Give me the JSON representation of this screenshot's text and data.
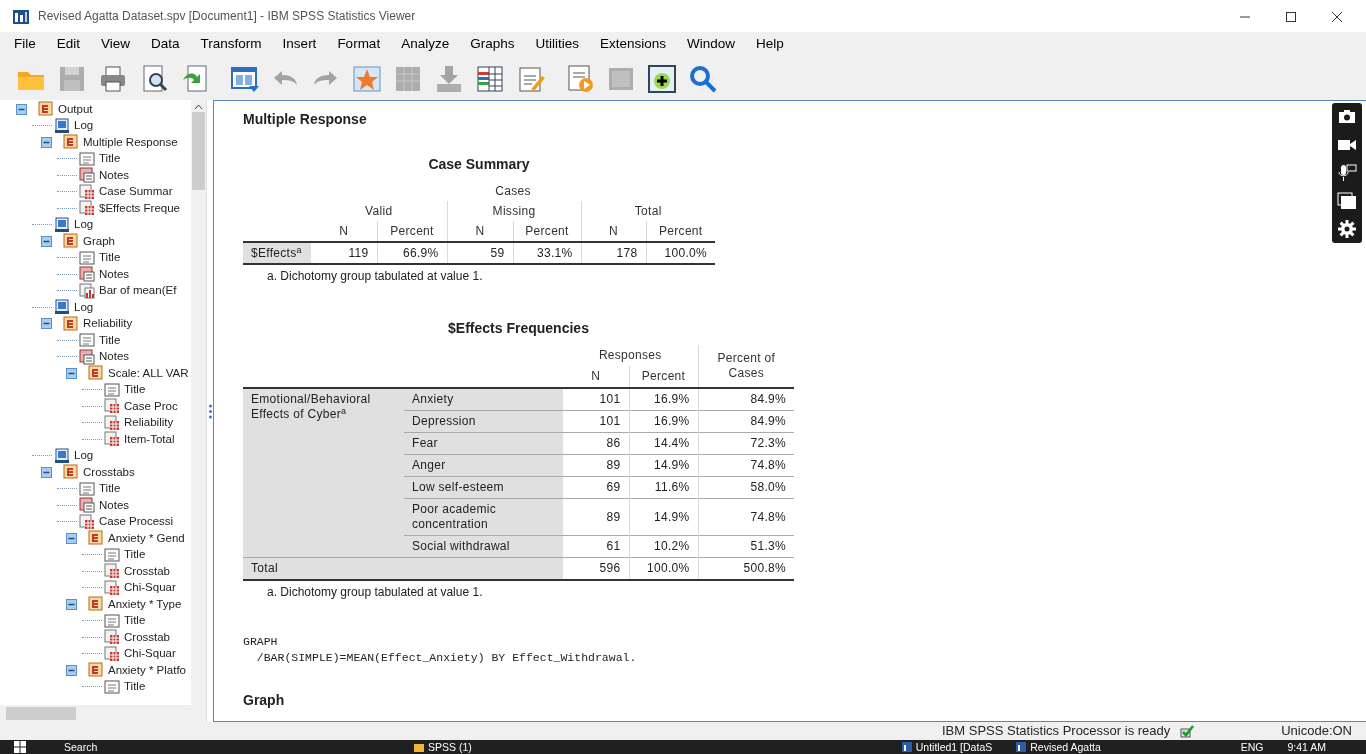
{
  "window": {
    "title": "Revised Agatta Dataset.spv [Document1] - IBM SPSS Statistics Viewer",
    "controls": [
      {
        "kind": "minimize"
      },
      {
        "kind": "maximize"
      },
      {
        "kind": "close"
      }
    ]
  },
  "menu": [
    {
      "label": "File"
    },
    {
      "label": "Edit"
    },
    {
      "label": "View"
    },
    {
      "label": "Data"
    },
    {
      "label": "Transform"
    },
    {
      "label": "Insert"
    },
    {
      "label": "Format"
    },
    {
      "label": "Analyze"
    },
    {
      "label": "Graphs"
    },
    {
      "label": "Utilities"
    },
    {
      "label": "Extensions"
    },
    {
      "label": "Window"
    },
    {
      "label": "Help"
    }
  ],
  "toolbar": [
    {
      "kind": "folder",
      "disabled": false
    },
    {
      "kind": "save",
      "disabled": true
    },
    {
      "kind": "print",
      "disabled": false
    },
    {
      "kind": "preview",
      "disabled": false
    },
    {
      "kind": "export",
      "disabled": false
    },
    {
      "kind": "window",
      "disabled": false
    },
    {
      "kind": "undo",
      "disabled": true
    },
    {
      "kind": "redo",
      "disabled": true
    },
    {
      "kind": "star",
      "disabled": false
    },
    {
      "kind": "grid",
      "disabled": true
    },
    {
      "kind": "download",
      "disabled": true
    },
    {
      "kind": "table",
      "disabled": false
    },
    {
      "kind": "edit",
      "disabled": false
    },
    {
      "kind": "play",
      "disabled": false
    },
    {
      "kind": "panel",
      "disabled": true
    },
    {
      "kind": "add",
      "disabled": false
    },
    {
      "kind": "search",
      "disabled": false
    }
  ],
  "tree": [
    {
      "label": "Output",
      "kind": "group",
      "expanded": true,
      "children": [
        {
          "label": "Log",
          "kind": "log"
        },
        {
          "label": "Multiple Response",
          "kind": "group",
          "expanded": true,
          "children": [
            {
              "label": "Title",
              "kind": "title"
            },
            {
              "label": "Notes",
              "kind": "notes"
            },
            {
              "label": "Case Summar",
              "kind": "table"
            },
            {
              "label": "$Effects Freque",
              "kind": "table"
            }
          ]
        },
        {
          "label": "Log",
          "kind": "log"
        },
        {
          "label": "Graph",
          "kind": "group",
          "expanded": true,
          "children": [
            {
              "label": "Title",
              "kind": "title"
            },
            {
              "label": "Notes",
              "kind": "notes"
            },
            {
              "label": "Bar of mean(Ef",
              "kind": "chart"
            }
          ]
        },
        {
          "label": "Log",
          "kind": "log"
        },
        {
          "label": "Reliability",
          "kind": "group",
          "expanded": true,
          "children": [
            {
              "label": "Title",
              "kind": "title"
            },
            {
              "label": "Notes",
              "kind": "notes"
            },
            {
              "label": "Scale: ALL VAR",
              "kind": "group",
              "expanded": true,
              "children": [
                {
                  "label": "Title",
                  "kind": "title"
                },
                {
                  "label": "Case Proc",
                  "kind": "table"
                },
                {
                  "label": "Reliability",
                  "kind": "table"
                },
                {
                  "label": "Item-Total",
                  "kind": "table"
                }
              ]
            }
          ]
        },
        {
          "label": "Log",
          "kind": "log"
        },
        {
          "label": "Crosstabs",
          "kind": "group",
          "expanded": true,
          "children": [
            {
              "label": "Title",
              "kind": "title"
            },
            {
              "label": "Notes",
              "kind": "notes"
            },
            {
              "label": "Case Processi",
              "kind": "table"
            },
            {
              "label": "Anxiety  * Gend",
              "kind": "group",
              "expanded": true,
              "children": [
                {
                  "label": "Title",
                  "kind": "title"
                },
                {
                  "label": "Crosstab",
                  "kind": "table"
                },
                {
                  "label": "Chi-Squar",
                  "kind": "table"
                }
              ]
            },
            {
              "label": "Anxiety  * Type",
              "kind": "group",
              "expanded": true,
              "children": [
                {
                  "label": "Title",
                  "kind": "title"
                },
                {
                  "label": "Crosstab",
                  "kind": "table"
                },
                {
                  "label": "Chi-Squar",
                  "kind": "table"
                }
              ]
            },
            {
              "label": "Anxiety  * Platfo",
              "kind": "group",
              "expanded": true,
              "children": [
                {
                  "label": "Title",
                  "kind": "title"
                }
              ]
            }
          ]
        }
      ]
    }
  ],
  "output": {
    "heading": "Multiple Response",
    "case_summary": {
      "title": "Case Summary",
      "group_header": "Cases",
      "groups": [
        "Valid",
        "Missing",
        "Total"
      ],
      "subheaders": [
        "N",
        "Percent",
        "N",
        "Percent",
        "N",
        "Percent"
      ],
      "rows": [
        {
          "label": "$Effects",
          "note": "a",
          "cells": [
            "119",
            "66.9%",
            "59",
            "33.1%",
            "178",
            "100.0%"
          ]
        }
      ],
      "footnote": "a. Dichotomy group tabulated at value 1."
    },
    "frequencies": {
      "title": "$Effects Frequencies",
      "group_header": "Responses",
      "subheaders": [
        "N",
        "Percent"
      ],
      "extra_header": "Percent of Cases",
      "group_label": "Emotional/Behavioral Effects of Cyber",
      "group_note": "a",
      "rows": [
        {
          "label": "Anxiety",
          "cells": [
            "101",
            "16.9%",
            "84.9%"
          ]
        },
        {
          "label": "Depression",
          "cells": [
            "101",
            "16.9%",
            "84.9%"
          ]
        },
        {
          "label": "Fear",
          "cells": [
            "86",
            "14.4%",
            "72.3%"
          ]
        },
        {
          "label": "Anger",
          "cells": [
            "89",
            "14.9%",
            "74.8%"
          ]
        },
        {
          "label": "Low self-esteem",
          "cells": [
            "69",
            "11.6%",
            "58.0%"
          ]
        },
        {
          "label": "Poor academic concentration",
          "cells": [
            "89",
            "14.9%",
            "74.8%"
          ]
        },
        {
          "label": "Social withdrawal",
          "cells": [
            "61",
            "10.2%",
            "51.3%"
          ]
        }
      ],
      "total": {
        "label": "Total",
        "cells": [
          "596",
          "100.0%",
          "500.8%"
        ]
      },
      "footnote": "a. Dichotomy group tabulated at value 1."
    },
    "syntax": [
      "GRAPH",
      "  /BAR(SIMPLE)=MEAN(Effect_Anxiety) BY Effect_Withdrawal."
    ],
    "next_heading": "Graph"
  },
  "capture_toolbar": [
    {
      "kind": "camera"
    },
    {
      "kind": "video"
    },
    {
      "kind": "mic"
    },
    {
      "kind": "window"
    },
    {
      "kind": "settings"
    }
  ],
  "status_bar": {
    "message": "IBM SPSS Statistics Processor is ready",
    "ready": true,
    "unicode": "Unicode:ON"
  },
  "taskbar": {
    "search": "Search",
    "apps": [
      {
        "label": "SPSS (1)",
        "kind": "folder"
      },
      {
        "label": "Untitled1 [DataS",
        "kind": "spss"
      },
      {
        "label": "Revised Agatta",
        "kind": "spss"
      }
    ],
    "language": "ENG",
    "time": "9:41 AM"
  }
}
